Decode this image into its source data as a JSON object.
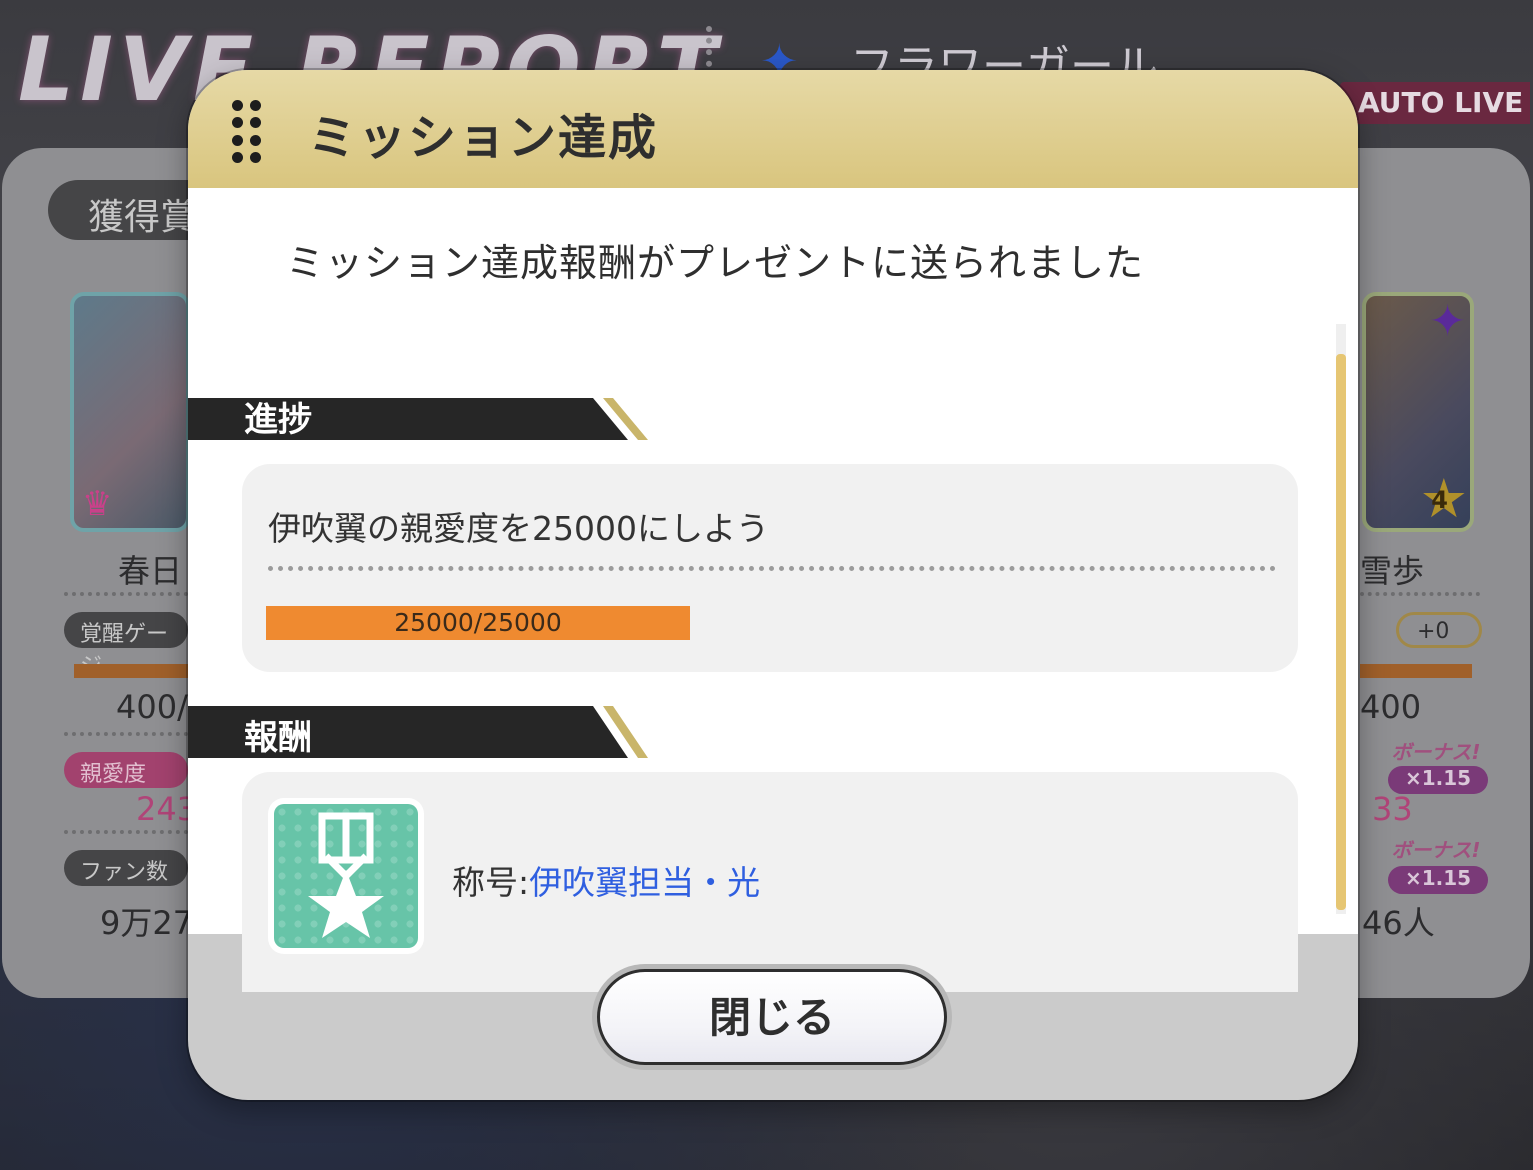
{
  "background": {
    "screen_title": "LIVE REPORT",
    "song_title": "フラワーガール",
    "auto_live_label": "AUTO LIVE",
    "awards_label": "獲得賞",
    "left_idol": {
      "name": "春日",
      "gauge_label": "覚醒ゲージ",
      "gauge_value": "400/",
      "affection_label": "親愛度",
      "affection_value": "243",
      "fans_label": "ファン数",
      "fans_value": "9万27"
    },
    "right_idol": {
      "name": "雪歩",
      "plus_badge": "+0",
      "gauge_value": "400",
      "bonus_label": "ボーナス!",
      "bonus_multiplier": "×1.15",
      "affection_value": "33",
      "fans_value": "46人",
      "star_rank": "4"
    }
  },
  "modal": {
    "title": "ミッション達成",
    "message": "ミッション達成報酬がプレゼントに送られました",
    "progress_section": {
      "label": "進捗",
      "mission_text": "伊吹翼の親愛度を25000にしよう",
      "progress_text": "25000/25000",
      "progress_fraction": 1.0
    },
    "reward_section": {
      "label": "報酬",
      "reward_prefix": "称号:",
      "reward_value": "伊吹翼担当・光",
      "icon": "medal-star-icon"
    },
    "close_button": "閉じる"
  },
  "colors": {
    "header_gold": "#d9c57e",
    "progress_orange": "#ef8a30",
    "reward_link_blue": "#2f5fe0",
    "medal_teal": "#67c4a8"
  }
}
